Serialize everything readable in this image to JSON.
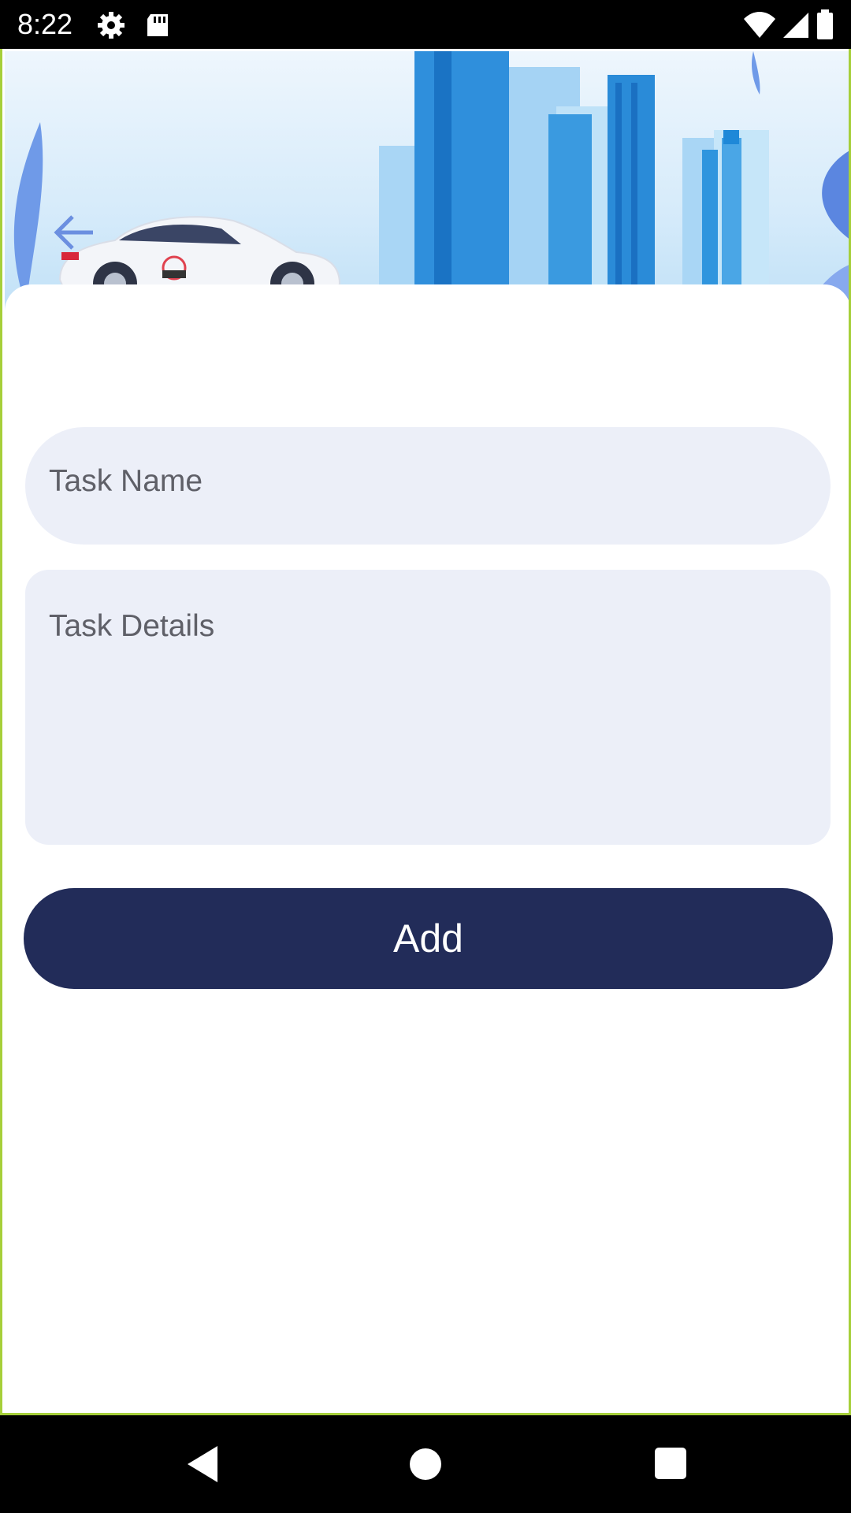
{
  "status_bar": {
    "time": "8:22",
    "left_icons": [
      "settings-gear-icon",
      "sd-card-icon"
    ],
    "right_icons": [
      "wifi-icon",
      "cell-signal-icon",
      "battery-icon"
    ]
  },
  "header": {
    "back_icon": "arrow-left-icon",
    "illustration": "city-skyline-with-taxi-car",
    "colors": {
      "sky": "#d6ebfa",
      "buildings": "#1e88d8",
      "back_arrow": "#6b8fe0"
    }
  },
  "form": {
    "task_name": {
      "placeholder": "Task Name",
      "value": ""
    },
    "task_details": {
      "placeholder": "Task Details",
      "value": ""
    },
    "add_label": "Add"
  },
  "colors": {
    "field_bg": "#eceff8",
    "button_bg": "#222c59",
    "button_text": "#ffffff"
  },
  "nav_bar": {
    "icons": [
      "nav-back-icon",
      "nav-home-icon",
      "nav-recents-icon"
    ]
  }
}
